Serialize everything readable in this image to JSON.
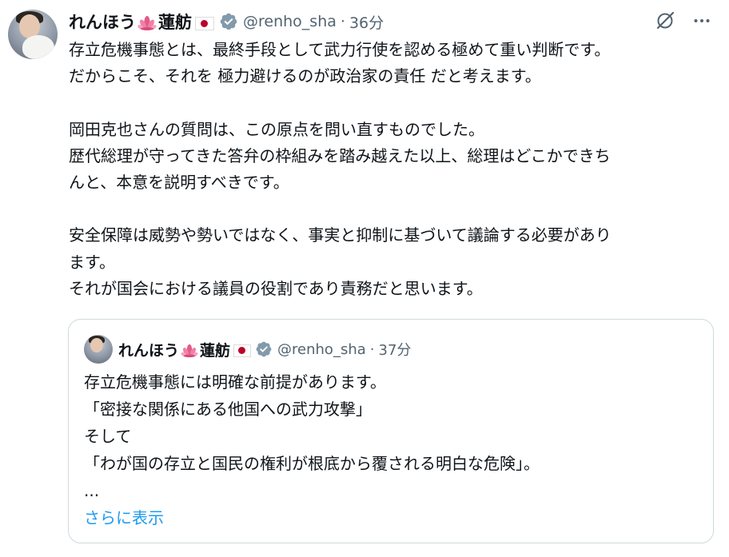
{
  "author": {
    "name_prefix": "れんほう",
    "name_suffix": "蓮舫",
    "handle": "@renho_sha",
    "separator": "·",
    "time": "36分",
    "lotus_icon": "lotus-emoji",
    "flag_icon": "japan-flag-emoji",
    "verified_color": "#829aab"
  },
  "post": {
    "lines": [
      "存立危機事態とは、最終手段として武力行使を認める極めて重い判断です。",
      "だからこそ、それを 極力避けるのが政治家の責任 だと考えます。",
      "",
      "岡田克也さんの質問は、この原点を問い直すものでした。",
      "歴代総理が守ってきた答弁の枠組みを踏み越えた以上、総理はどこかできち",
      "んと、本意を説明すべきです。",
      "",
      "安全保障は威勢や勢いではなく、事実と抑制に基づいて議論する必要があり",
      "ます。",
      "それが国会における議員の役割であり責務だと思います。"
    ]
  },
  "quoted": {
    "name_prefix": "れんほう",
    "name_suffix": "蓮舫",
    "handle": "@renho_sha",
    "separator": "·",
    "time": "37分",
    "lines": [
      "存立危機事態には明確な前提があります。",
      "「密接な関係にある他国への武力攻撃」",
      "そして",
      "「わが国の存立と国民の権利が根底から覆される明白な危険」。",
      "..."
    ],
    "show_more": "さらに表示"
  },
  "actions": {
    "grok_icon": "grok-slash-icon",
    "more_icon": "more-dots-icon"
  },
  "colors": {
    "text": "#0f1419",
    "secondary": "#536471",
    "link": "#1d9bf0",
    "border": "#cfd9de",
    "flag_red": "#bc002d"
  }
}
